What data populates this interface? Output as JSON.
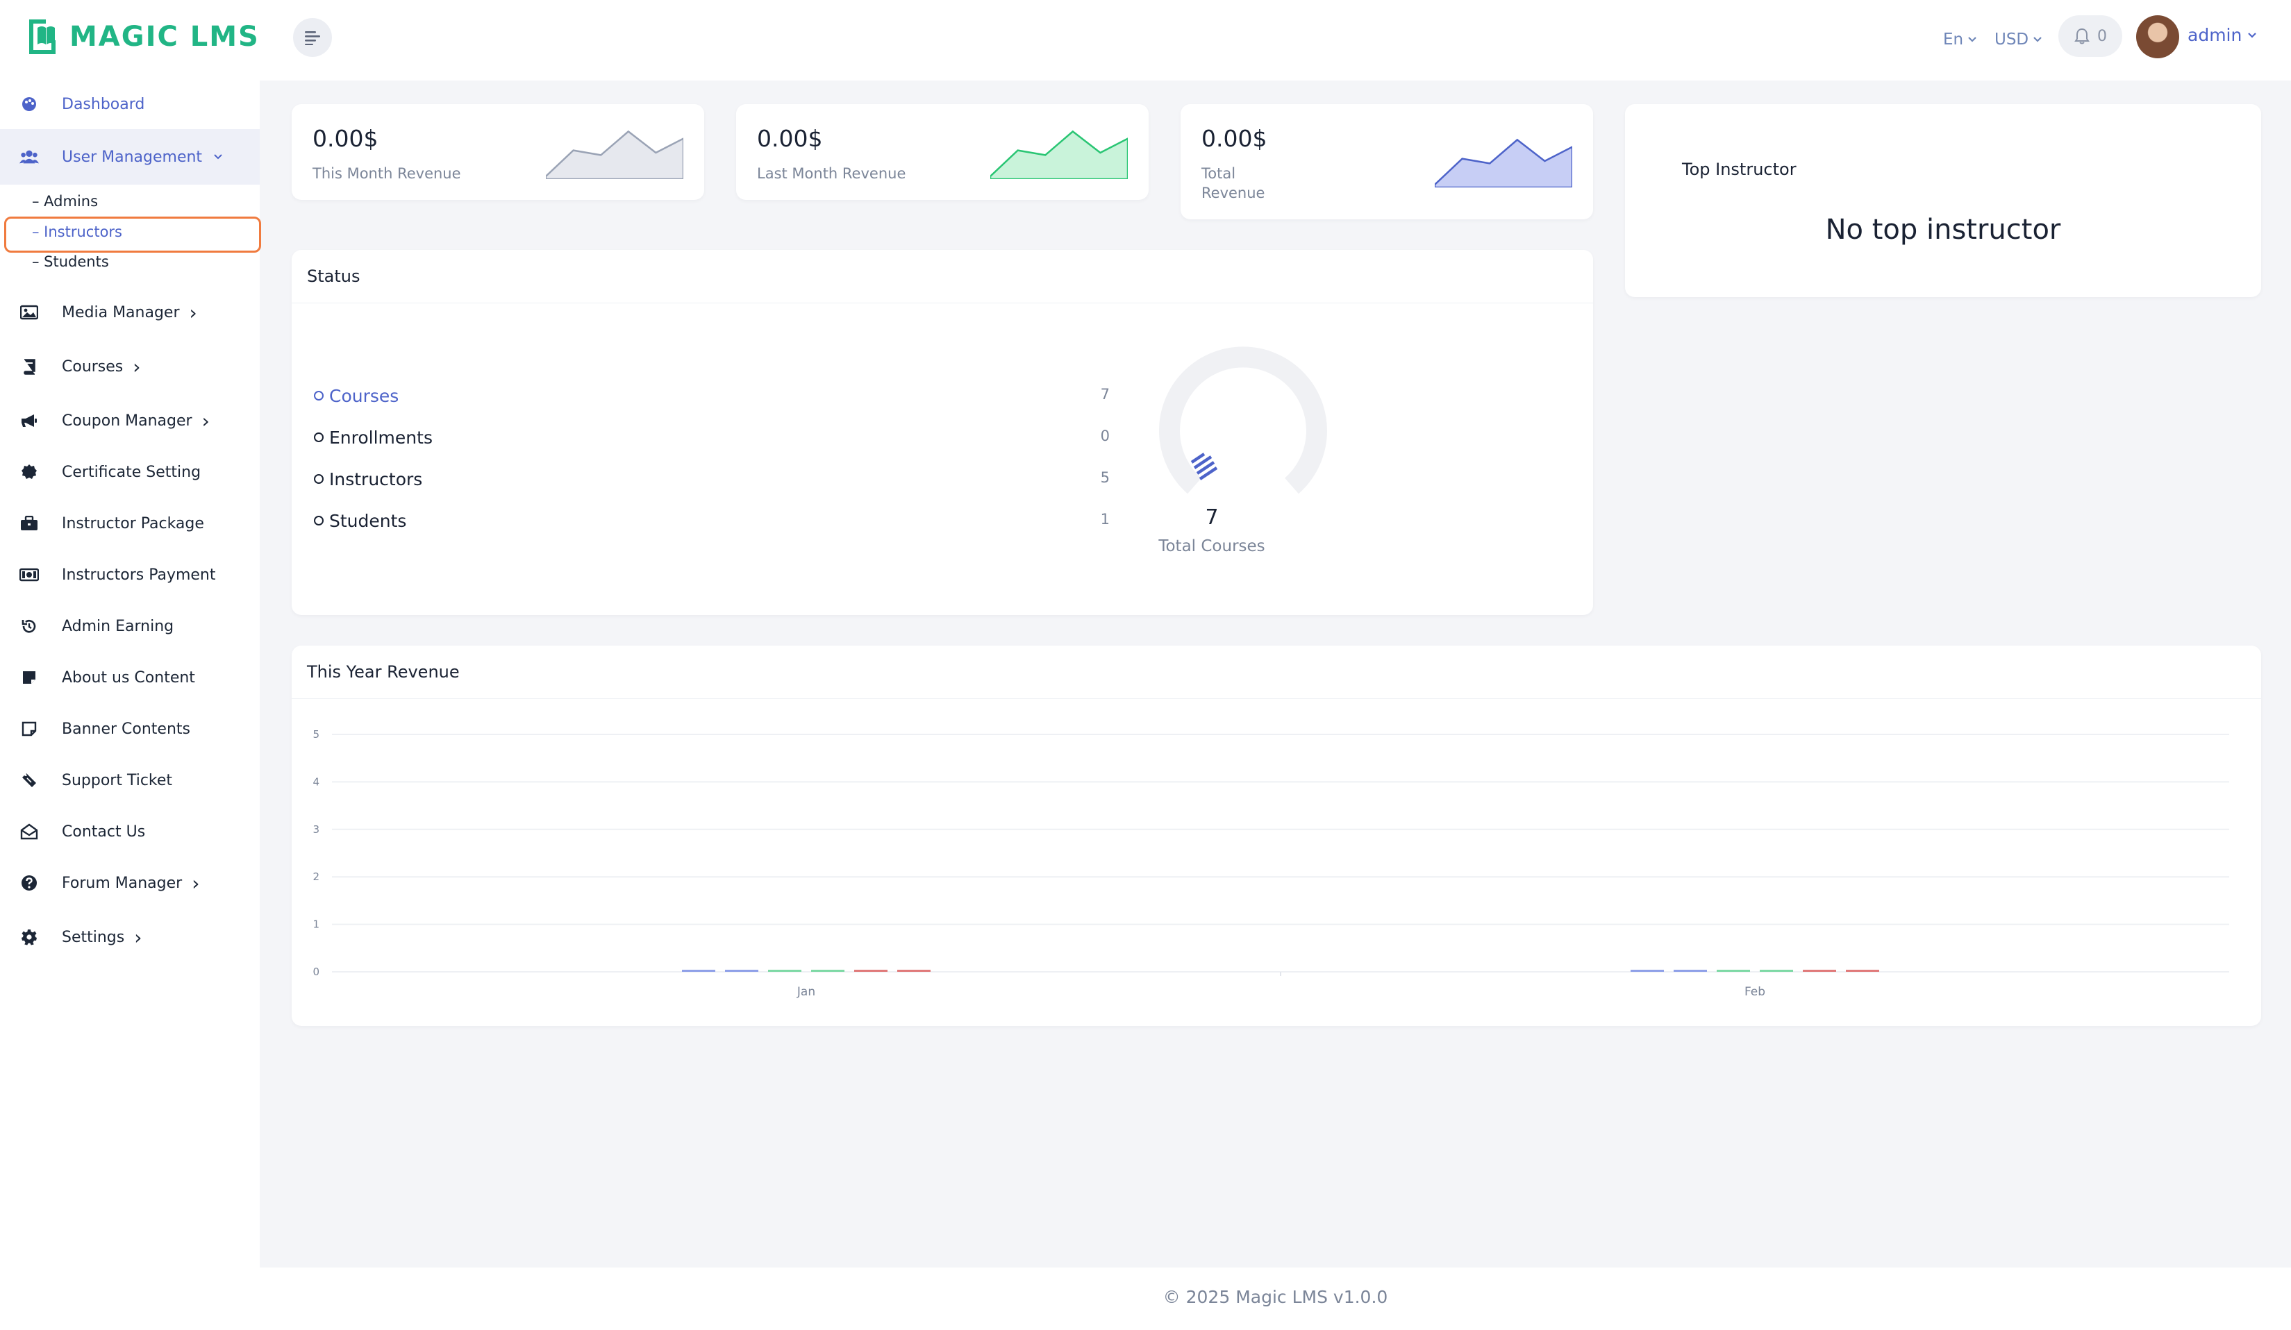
{
  "app": {
    "logo_text": "MAGIC LMS",
    "brand_color": "#21b585",
    "accent_color": "#4d63c9",
    "highlight_color": "#f07b3f"
  },
  "header": {
    "menu_icon": "menu-lines-icon",
    "language": "En",
    "currency": "USD",
    "notification_count": "0",
    "user_name": "admin"
  },
  "sidebar": {
    "items": [
      {
        "label": "Dashboard",
        "icon": "palette-icon",
        "chevron": ""
      },
      {
        "label": "User Management",
        "icon": "users-icon",
        "chevron": "⌄"
      },
      {
        "label": "Media Manager",
        "icon": "image-icon",
        "chevron": "›"
      },
      {
        "label": "Courses",
        "icon": "book-icon",
        "chevron": "›"
      },
      {
        "label": "Coupon Manager",
        "icon": "megaphone-icon",
        "chevron": "›"
      },
      {
        "label": "Certificate Setting",
        "icon": "certificate-icon",
        "chevron": ""
      },
      {
        "label": "Instructor Package",
        "icon": "briefcase-icon",
        "chevron": ""
      },
      {
        "label": "Instructors Payment",
        "icon": "money-bill-icon",
        "chevron": ""
      },
      {
        "label": "Admin Earning",
        "icon": "history-icon",
        "chevron": ""
      },
      {
        "label": "About us Content",
        "icon": "sticky-note-icon",
        "chevron": ""
      },
      {
        "label": "Banner Contents",
        "icon": "note-outline-icon",
        "chevron": ""
      },
      {
        "label": "Support Ticket",
        "icon": "ticket-icon",
        "chevron": ""
      },
      {
        "label": "Contact Us",
        "icon": "envelope-open-icon",
        "chevron": ""
      },
      {
        "label": "Forum Manager",
        "icon": "question-circle-icon",
        "chevron": "›"
      },
      {
        "label": "Settings",
        "icon": "cog-icon",
        "chevron": "›"
      }
    ],
    "user_management_sub": [
      "– Admins",
      "– Instructors",
      "– Students"
    ]
  },
  "stats": [
    {
      "value": "0.00$",
      "label": "This Month Revenue",
      "color": "#9aa3b5",
      "trend": [
        0.0,
        0.55,
        0.45,
        0.95,
        0.5,
        0.8
      ]
    },
    {
      "value": "0.00$",
      "label": "Last Month Revenue",
      "color": "#29c573",
      "trend": [
        0.0,
        0.55,
        0.45,
        0.95,
        0.5,
        0.8
      ]
    },
    {
      "value": "0.00$",
      "label_line1": "Total",
      "label_line2": "Revenue",
      "color": "#4d63c9",
      "trend": [
        0.0,
        0.55,
        0.45,
        0.95,
        0.5,
        0.8
      ]
    }
  ],
  "top_instructor": {
    "title": "Top Instructor",
    "message": "No top instructor"
  },
  "status": {
    "title": "Status",
    "rows": [
      {
        "label": "Courses",
        "value": "7"
      },
      {
        "label": "Enrollments",
        "value": "0"
      },
      {
        "label": "Instructors",
        "value": "5"
      },
      {
        "label": "Students",
        "value": "1"
      }
    ],
    "donut_value": "7",
    "donut_label": "Total Courses"
  },
  "chart_data": {
    "type": "bar",
    "title": "This Year Revenue",
    "categories": [
      "Jan",
      "Feb"
    ],
    "yticks": [
      "0",
      "1",
      "2",
      "3",
      "4",
      "5"
    ],
    "ylim": [
      0,
      5
    ],
    "grid": true,
    "series": [
      {
        "color": "#8fa0e8",
        "values": [
          0,
          0
        ]
      },
      {
        "color": "#8fa0e8",
        "values": [
          0,
          0
        ]
      },
      {
        "color": "#7ed9a5",
        "values": [
          0,
          0
        ]
      },
      {
        "color": "#7ed9a5",
        "values": [
          0,
          0
        ]
      },
      {
        "color": "#e07a7a",
        "values": [
          0,
          0
        ]
      },
      {
        "color": "#e07a7a",
        "values": [
          0,
          0
        ]
      }
    ]
  },
  "footer": {
    "text": "© 2025 Magic LMS v1.0.0"
  }
}
